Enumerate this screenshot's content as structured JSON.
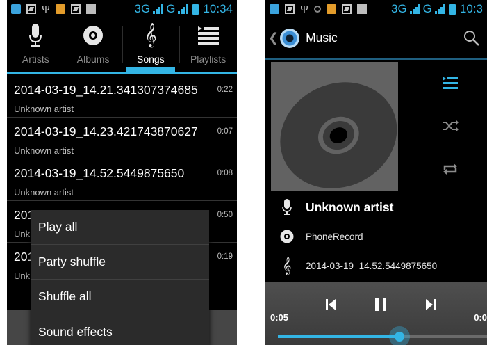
{
  "left": {
    "status": {
      "network": "3G",
      "clock": "10:34"
    },
    "tabs": [
      {
        "label": "Artists",
        "icon": "microphone-icon"
      },
      {
        "label": "Albums",
        "icon": "disc-icon"
      },
      {
        "label": "Songs",
        "icon": "treble-clef-icon",
        "active": true
      },
      {
        "label": "Playlists",
        "icon": "playlist-icon"
      }
    ],
    "songs": [
      {
        "title": "2014-03-19_14.21.341307374685",
        "artist": "Unknown artist",
        "duration": "0:22"
      },
      {
        "title": "2014-03-19_14.23.421743870627",
        "artist": "Unknown artist",
        "duration": "0:07"
      },
      {
        "title": "2014-03-19_14.52.5449875650",
        "artist": "Unknown artist",
        "duration": "0:08"
      },
      {
        "title": "201",
        "artist": "Unk",
        "duration": "0:50"
      },
      {
        "title": "201",
        "artist": "Unk",
        "duration": "0:19"
      }
    ],
    "context_menu": [
      "Play all",
      "Party shuffle",
      "Shuffle all",
      "Sound effects"
    ]
  },
  "right": {
    "status": {
      "network": "3G",
      "clock": "10:3"
    },
    "app_title": "Music",
    "track": {
      "artist": "Unknown artist",
      "album": "PhoneRecord",
      "title": "2014-03-19_14.52.5449875650"
    },
    "playback": {
      "elapsed": "0:05",
      "total": "0:0",
      "progress_fraction": 0.58
    }
  },
  "colors": {
    "accent": "#33b5e5",
    "background": "#000000",
    "menu": "#2b2b2b"
  }
}
